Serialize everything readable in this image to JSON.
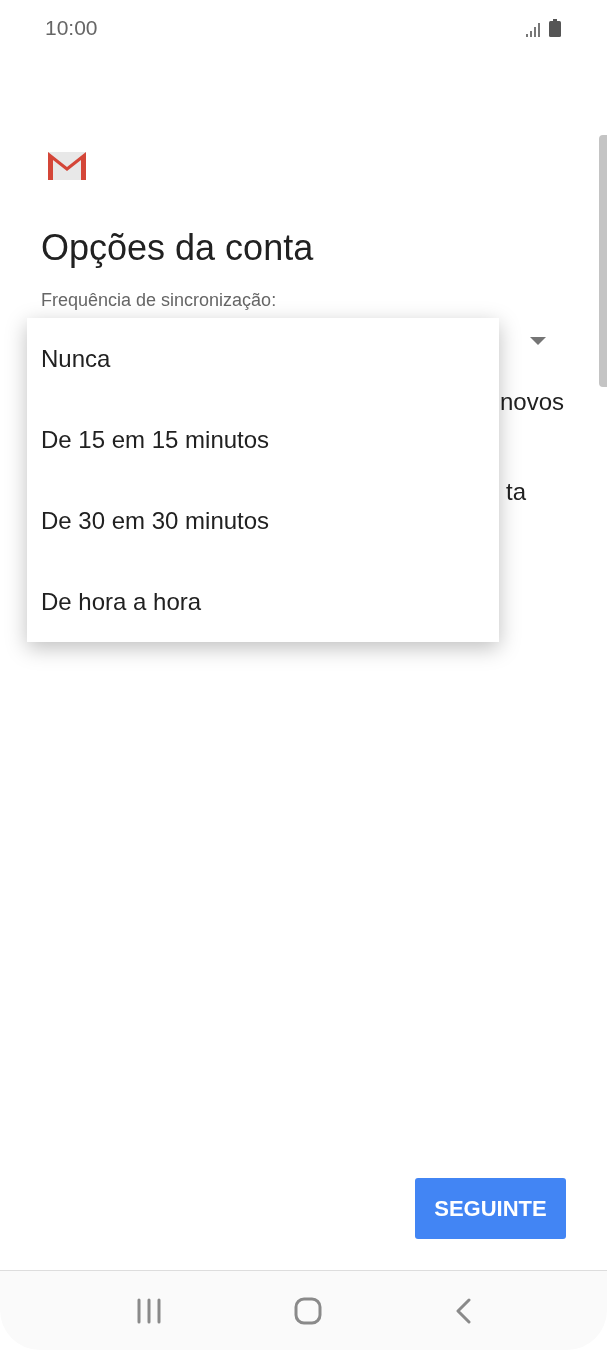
{
  "status_bar": {
    "time": "10:00"
  },
  "title": "Opções da conta",
  "sync": {
    "label": "Frequência de sincronização:",
    "expanded": true
  },
  "background_lines": [
    "novos",
    "ta"
  ],
  "menu": [
    {
      "label": "Nunca"
    },
    {
      "label": "De 15 em 15 minutos"
    },
    {
      "label": "De 30 em 30 minutos"
    },
    {
      "label": "De hora a hora"
    }
  ],
  "next_button": "SEGUINTE"
}
